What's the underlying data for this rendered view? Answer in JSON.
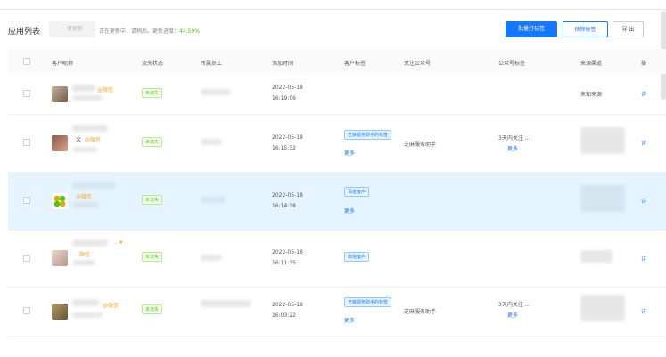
{
  "header": {
    "title": "应用列表",
    "update_button": "一键更新",
    "update_status": "正在更新中，请稍后。更新进度：",
    "update_progress": "44.59%",
    "batch_tag_button": "批量打标签",
    "remove_tag_button": "移除标签",
    "export_button": "导 出"
  },
  "table": {
    "columns": [
      "客户昵称",
      "流失状态",
      "所属员工",
      "添加时间",
      "客户标签",
      "关注公众号",
      "公众号标签",
      "来源渠道",
      "操"
    ],
    "rows": [
      {
        "wechat": "@微信",
        "status": "未流失",
        "date": "2022-05-18",
        "time": "16:19:06",
        "tag": "",
        "more": "",
        "account": "",
        "acct_tag": "",
        "acct_more": "",
        "source": "未知来源"
      },
      {
        "nick_prefix": "义",
        "wechat": "@微信",
        "status": "未流失",
        "date": "2022-05-18",
        "time": "16:15:32",
        "tag": "芝麻服务助手的标签",
        "more": "更多",
        "account": "芝麻服务助手",
        "acct_tag": "3天内关注 ...",
        "acct_more": "更多",
        "source": ""
      },
      {
        "wechat": "@微信",
        "status": "未流失",
        "date": "2022-05-18",
        "time": "16:14:38",
        "tag": "百度客户",
        "more": "更多",
        "account": "",
        "acct_tag": "",
        "acct_more": "",
        "source": ""
      },
      {
        "wechat": "微信",
        "status": "未流失",
        "date": "2022-05-18",
        "time": "16:11:35",
        "tag": "微信客户",
        "more": "",
        "account": "",
        "acct_tag": "",
        "acct_more": "",
        "source": ""
      },
      {
        "wechat": "@微信",
        "status": "未流失",
        "date": "2022-05-18",
        "time": "16:03:22",
        "tag": "芝麻服务助手的标签",
        "more": "更多",
        "account": "芝麻服务助手",
        "acct_tag": "3天内关注 ...",
        "acct_more": "更多",
        "source": ""
      }
    ],
    "op_label": "详"
  },
  "colors": {
    "primary": "#1677ff",
    "success": "#52c41a",
    "wechat": "#f5a623",
    "highlight": "#e6f4ff"
  }
}
